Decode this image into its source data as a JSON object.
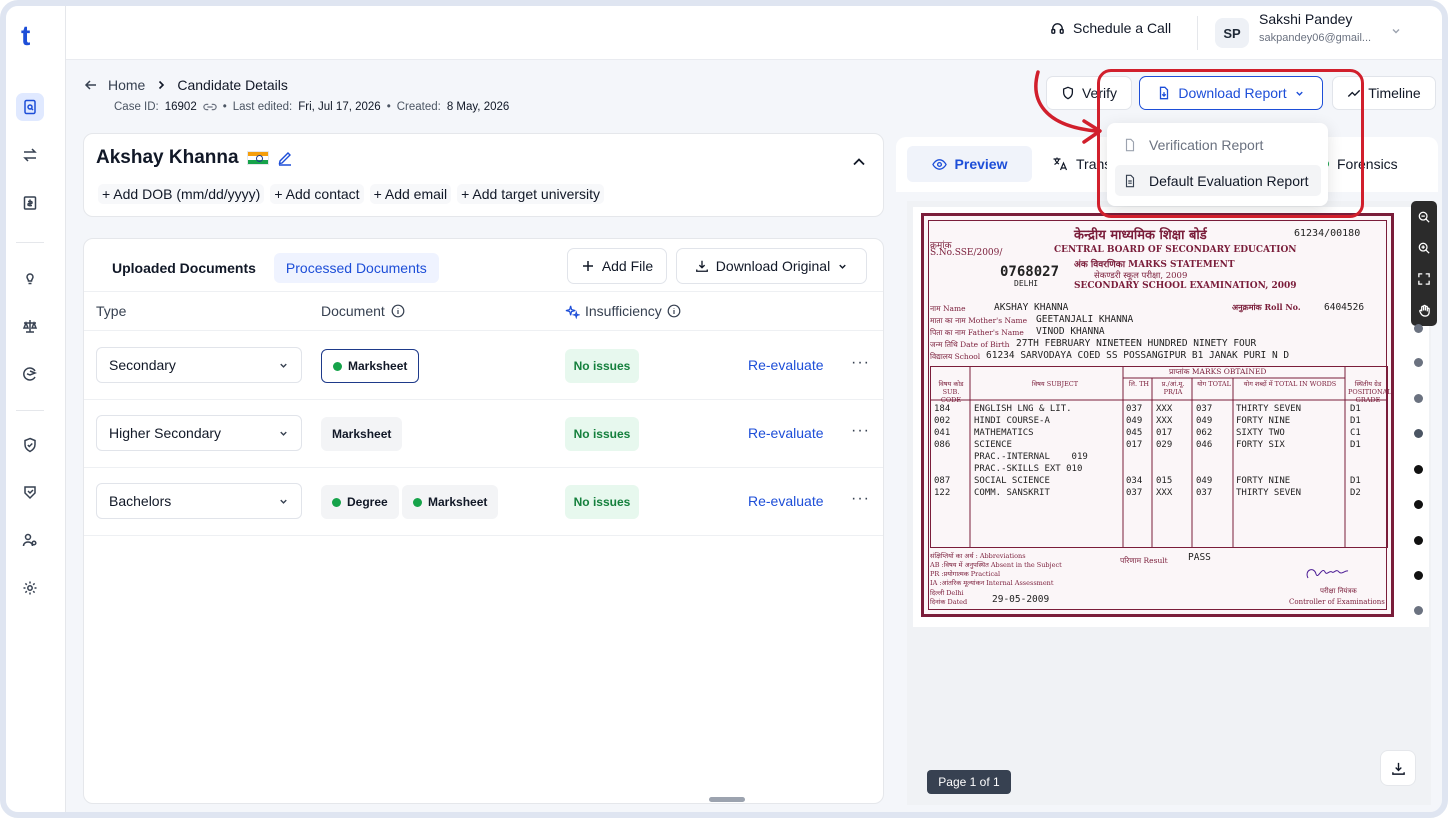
{
  "header": {
    "schedule_call": "Schedule a Call",
    "avatar_initials": "SP",
    "user_name": "Sakshi Pandey",
    "user_email": "sakpandey06@gmail..."
  },
  "breadcrumb": {
    "home": "Home",
    "current": "Candidate Details",
    "case_label": "Case ID:",
    "case_id": "16902",
    "last_edited_label": "Last edited:",
    "last_edited": "Fri, Jul 17, 2026",
    "created_label": "Created:",
    "created": "8 May, 2026"
  },
  "actions": {
    "verify": "Verify",
    "download_report": "Download Report",
    "timeline": "Timeline"
  },
  "download_menu": {
    "items": [
      "Verification Report",
      "Default Evaluation Report"
    ]
  },
  "candidate": {
    "name": "Akshay Khanna",
    "add_dob": "+ Add DOB (mm/dd/yyyy)",
    "add_contact": "+ Add contact",
    "add_email": "+ Add email",
    "add_university": "+ Add target university"
  },
  "documents": {
    "tab_uploaded": "Uploaded Documents",
    "tab_processed": "Processed Documents",
    "add_file": "Add File",
    "download_original": "Download Original",
    "col_type": "Type",
    "col_document": "Document",
    "col_insufficiency": "Insufficiency",
    "rows": [
      {
        "type": "Secondary",
        "status": "No issues",
        "action": "Re-evaluate",
        "docs": [
          "Marksheet"
        ]
      },
      {
        "type": "Higher Secondary",
        "status": "No issues",
        "action": "Re-evaluate",
        "docs": [
          "Marksheet"
        ]
      },
      {
        "type": "Bachelors",
        "status": "No issues",
        "action": "Re-evaluate",
        "docs": [
          "Degree",
          "Marksheet"
        ]
      }
    ]
  },
  "preview": {
    "tab_preview": "Preview",
    "tab_translate": "Trans",
    "tab_forensics": "Forensics",
    "page_indicator": "Page 1 of 1"
  },
  "sheet": {
    "title_hi": "केन्द्रीय माध्यमिक शिक्षा बोर्ड",
    "serial_hi": "क्रमांक",
    "serial": "S.No.SSE/2009/",
    "cert_no": "61234/00180",
    "board": "CENTRAL BOARD OF SECONDARY EDUCATION",
    "statement_hi": "अंक विवरणिका MARKS STATEMENT",
    "exam_hi": "सेकण्डरी स्कूल परीक्षा, 2009",
    "number": "0768027",
    "city": "DELHI",
    "exam": "SECONDARY SCHOOL EXAMINATION, 2009",
    "name_label": "नाम Name",
    "name": "AKSHAY KHANNA",
    "roll_label": "अनुक्रमांक Roll No.",
    "roll": "6404526",
    "mother_label": "माता का नाम Mother's Name",
    "mother": "GEETANJALI KHANNA",
    "father_label": "पिता का नाम Father's Name",
    "father": "VINOD KHANNA",
    "dob_label": "जन्म तिथि Date of Birth",
    "dob": "27TH FEBRUARY NINETEEN HUNDRED NINETY FOUR",
    "school_label": "विद्यालय School",
    "school": "61234  SARVODAYA COED SS POSSANGIPUR B1 JANAK PURI N D",
    "table_heads": [
      "विषय कोड SUB. CODE",
      "विषय SUBJECT",
      "लि. TH",
      "प्र./आं.मू. PR/IA",
      "योग TOTAL",
      "योग शब्दों में TOTAL IN WORDS",
      "स्थितीय ग्रेड POSITIONAL GRADE"
    ],
    "marks_head": "प्राप्तांक  MARKS OBTAINED",
    "subjects": [
      [
        "184",
        "ENGLISH LNG & LIT.",
        "037",
        "XXX",
        "037",
        "THIRTY SEVEN",
        "D1"
      ],
      [
        "002",
        "HINDI COURSE-A",
        "049",
        "XXX",
        "049",
        "FORTY NINE",
        "D1"
      ],
      [
        "041",
        "MATHEMATICS",
        "045",
        "017",
        "062",
        "SIXTY TWO",
        "C1"
      ],
      [
        "086",
        "SCIENCE",
        "017",
        "029",
        "046",
        "FORTY SIX",
        "D1"
      ],
      [
        "",
        "PRAC.-INTERNAL    019",
        "",
        "",
        "",
        "",
        ""
      ],
      [
        "",
        "PRAC.-SKILLS EXT 010",
        "",
        "",
        "",
        "",
        ""
      ],
      [
        "087",
        "SOCIAL SCIENCE",
        "034",
        "015",
        "049",
        "FORTY NINE",
        "D1"
      ],
      [
        "122",
        "COMM. SANSKRIT",
        "037",
        "XXX",
        "037",
        "THIRTY SEVEN",
        "D2"
      ]
    ],
    "abbrev": "संक्षिप्तियों का अर्थ : Abbreviations",
    "ab": "AB :विषय में अनुपस्थित Absent in the Subject",
    "pr": "PR :प्रयोगात्मक  Practical",
    "ia": "IA :आंतरिक मूल्यांकन Internal Assessment",
    "place": "दिल्ली Delhi",
    "date_label": "दिनांक Dated",
    "date": "29-05-2009",
    "result_label": "परिणाम Result",
    "result": "PASS",
    "controller_hi": "परीक्षा नियंत्रक",
    "controller": "Controller of Examinations"
  },
  "colors": {
    "accent": "#1d4ed8",
    "success": "#15803d",
    "highlight": "#d11f2c",
    "sheet_border": "#7a1d3a"
  }
}
